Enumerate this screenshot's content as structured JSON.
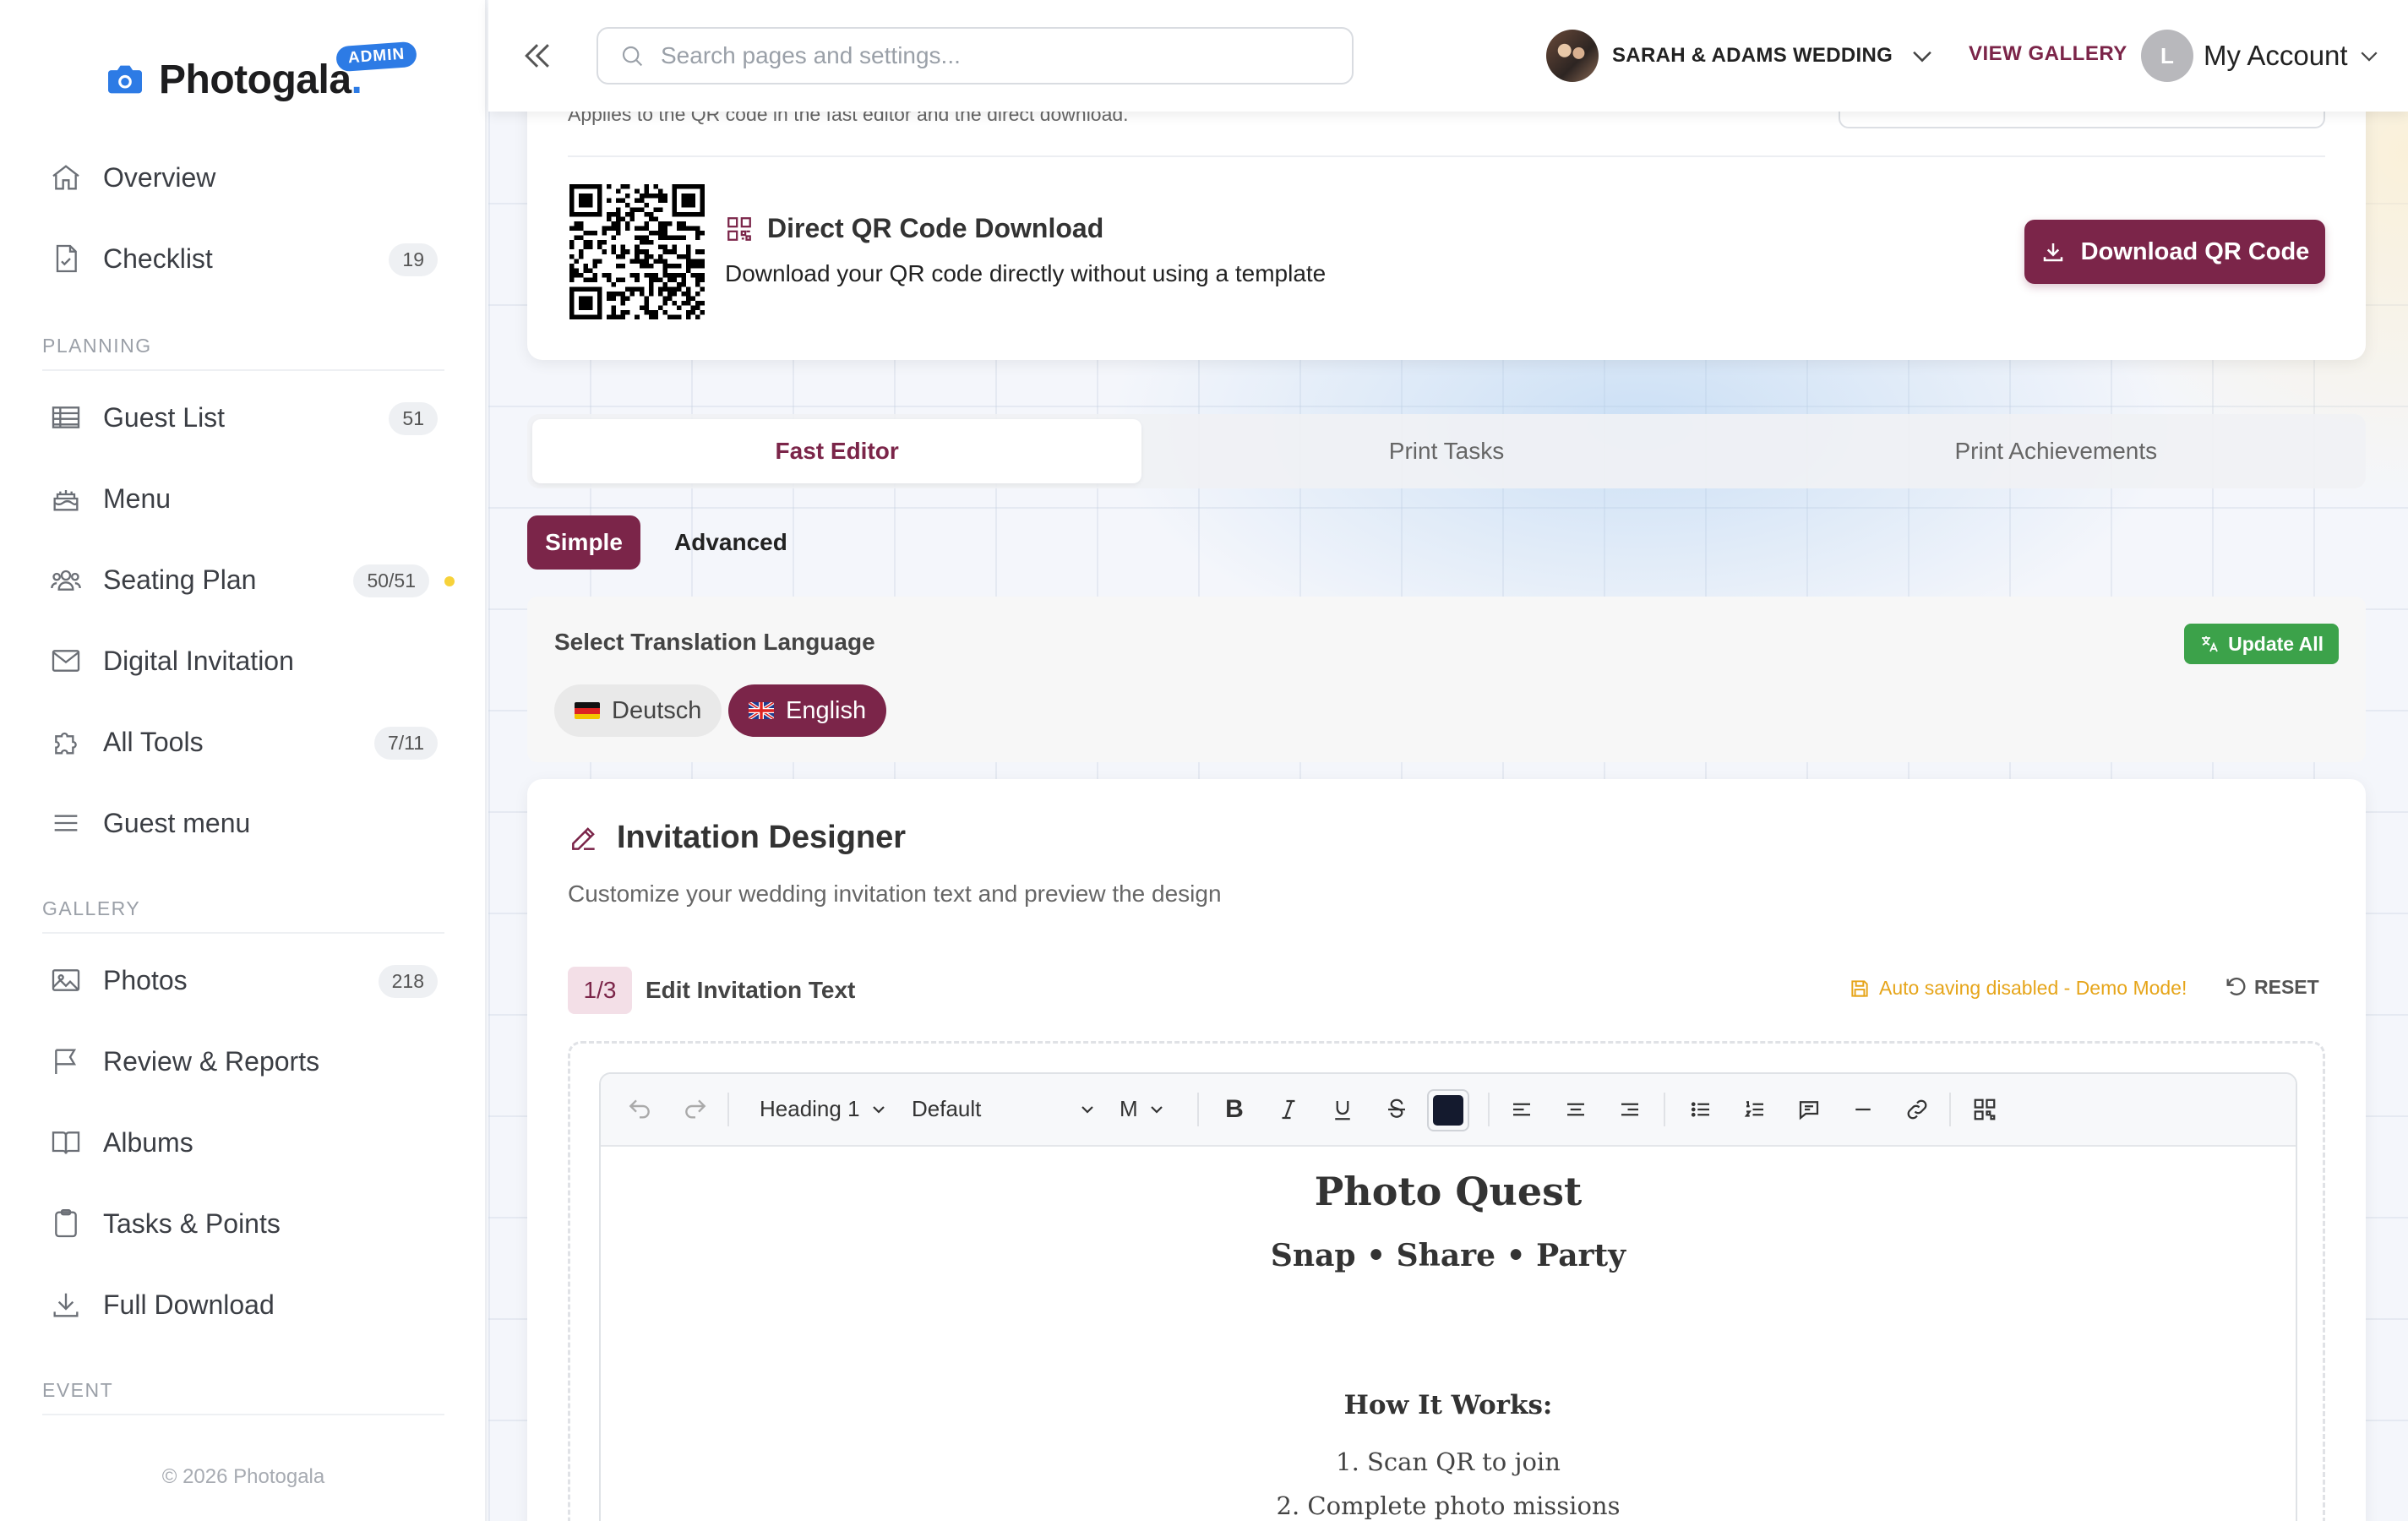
{
  "brand": {
    "name": "Photogala",
    "dot": ".",
    "badge": "ADMIN",
    "accent": "#2d7be5"
  },
  "sidebar": {
    "items_top": [
      {
        "label": "Overview",
        "icon": "home-icon"
      },
      {
        "label": "Checklist",
        "icon": "checklist-icon",
        "count": "19"
      }
    ],
    "section_planning": "PLANNING",
    "items_planning": [
      {
        "label": "Guest List",
        "icon": "table-icon",
        "count": "51"
      },
      {
        "label": "Menu",
        "icon": "cake-icon"
      },
      {
        "label": "Seating Plan",
        "icon": "people-icon",
        "count": "50/51"
      },
      {
        "label": "Digital Invitation",
        "icon": "mail-icon"
      },
      {
        "label": "All Tools",
        "icon": "puzzle-icon",
        "count": "7/11"
      },
      {
        "label": "Guest menu",
        "icon": "menu-lines-icon"
      }
    ],
    "section_gallery": "GALLERY",
    "items_gallery": [
      {
        "label": "Photos",
        "icon": "image-icon",
        "count": "218"
      },
      {
        "label": "Review & Reports",
        "icon": "flag-icon"
      },
      {
        "label": "Albums",
        "icon": "book-icon"
      },
      {
        "label": "Tasks & Points",
        "icon": "clipboard-icon"
      },
      {
        "label": "Full Download",
        "icon": "download-icon"
      }
    ],
    "section_event": "EVENT",
    "footer": "© 2026 Photogala"
  },
  "topbar": {
    "search_placeholder": "Search pages and settings...",
    "event_name": "SARAH & ADAMS WEDDING",
    "view_gallery": "VIEW GALLERY",
    "account_initial": "L",
    "account_label": "My Account"
  },
  "qr": {
    "note": "Applies to the QR code in the fast editor and the direct download.",
    "title": "Direct QR Code Download",
    "description": "Download your QR code directly without using a template",
    "button": "Download QR Code"
  },
  "tabs": [
    {
      "label": "Fast Editor",
      "active": true
    },
    {
      "label": "Print Tasks",
      "active": false
    },
    {
      "label": "Print Achievements",
      "active": false
    }
  ],
  "mode": {
    "simple": "Simple",
    "advanced": "Advanced"
  },
  "translation": {
    "title": "Select Translation Language",
    "update_button": "Update All",
    "languages": [
      {
        "label": "Deutsch",
        "selected": false
      },
      {
        "label": "English",
        "selected": true
      }
    ]
  },
  "designer": {
    "title": "Invitation Designer",
    "subtitle": "Customize your wedding invitation text and preview the design",
    "step": "1/3",
    "step_title": "Edit Invitation Text",
    "autosave": "Auto saving disabled - Demo Mode!",
    "reset": "RESET",
    "toolbar": {
      "heading": "Heading 1",
      "font": "Default",
      "size": "M",
      "text_color": "#141a2e"
    },
    "content": {
      "h1": "Photo Quest",
      "h2": "Snap • Share • Party",
      "h3": "How It Works:",
      "steps": [
        "1. Scan QR to join",
        "2. Complete photo missions"
      ]
    }
  },
  "colors": {
    "primary": "#7b2549",
    "success": "#3ca24a",
    "warning": "#e6a51a",
    "link": "#2d7be5"
  }
}
